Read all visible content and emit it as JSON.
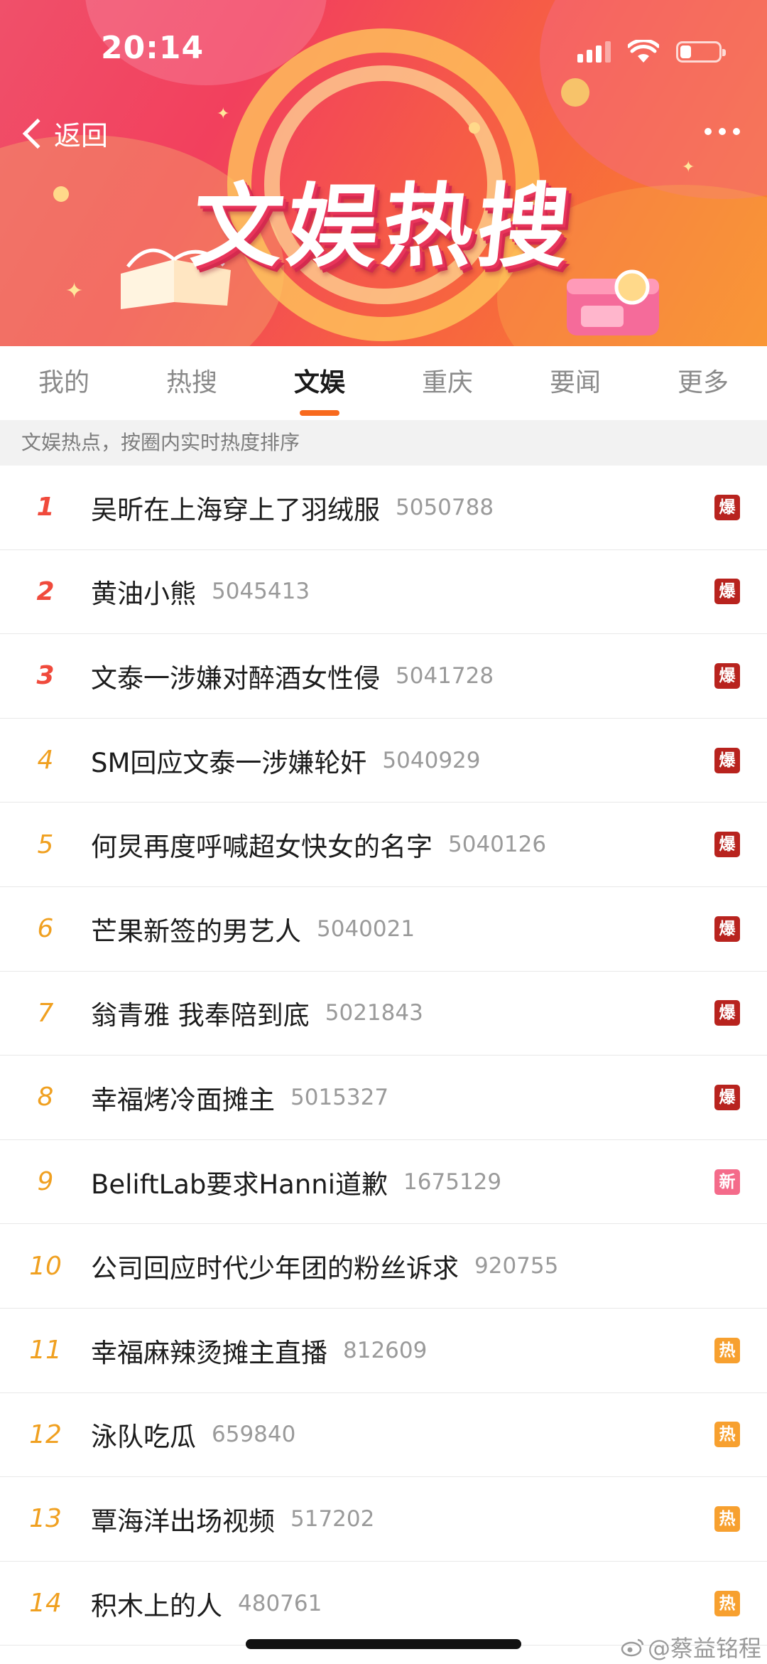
{
  "status_bar": {
    "time": "20:14",
    "battery_level": 0.25
  },
  "header": {
    "back_label": "返回",
    "banner_title": "文娱热搜"
  },
  "tabs": [
    {
      "label": "我的",
      "active": false
    },
    {
      "label": "热搜",
      "active": false
    },
    {
      "label": "文娱",
      "active": true
    },
    {
      "label": "重庆",
      "active": false
    },
    {
      "label": "要闻",
      "active": false
    },
    {
      "label": "更多",
      "active": false
    }
  ],
  "subheader": "文娱热点，按圈内实时热度排序",
  "badge_colors": {
    "爆": "#b8231e",
    "新": "#f46b8a",
    "热": "#f7a02f"
  },
  "items": [
    {
      "rank": "1",
      "title": "吴昕在上海穿上了羽绒服",
      "count": "5050788",
      "badge": "爆"
    },
    {
      "rank": "2",
      "title": "黄油小熊",
      "count": "5045413",
      "badge": "爆"
    },
    {
      "rank": "3",
      "title": "文泰一涉嫌对醉酒女性侵",
      "count": "5041728",
      "badge": "爆"
    },
    {
      "rank": "4",
      "title": "SM回应文泰一涉嫌轮奸",
      "count": "5040929",
      "badge": "爆"
    },
    {
      "rank": "5",
      "title": "何炅再度呼喊超女快女的名字",
      "count": "5040126",
      "badge": "爆"
    },
    {
      "rank": "6",
      "title": "芒果新签的男艺人",
      "count": "5040021",
      "badge": "爆"
    },
    {
      "rank": "7",
      "title": "翁青雅 我奉陪到底",
      "count": "5021843",
      "badge": "爆"
    },
    {
      "rank": "8",
      "title": "幸福烤冷面摊主",
      "count": "5015327",
      "badge": "爆"
    },
    {
      "rank": "9",
      "title": "BeliftLab要求Hanni道歉",
      "count": "1675129",
      "badge": "新"
    },
    {
      "rank": "10",
      "title": "公司回应时代少年团的粉丝诉求",
      "count": "920755",
      "badge": ""
    },
    {
      "rank": "11",
      "title": "幸福麻辣烫摊主直播",
      "count": "812609",
      "badge": "热"
    },
    {
      "rank": "12",
      "title": "泳队吃瓜",
      "count": "659840",
      "badge": "热"
    },
    {
      "rank": "13",
      "title": "覃海洋出场视频",
      "count": "517202",
      "badge": "热"
    },
    {
      "rank": "14",
      "title": "积木上的人",
      "count": "480761",
      "badge": "热"
    }
  ],
  "watermark": "@蔡益铭程"
}
